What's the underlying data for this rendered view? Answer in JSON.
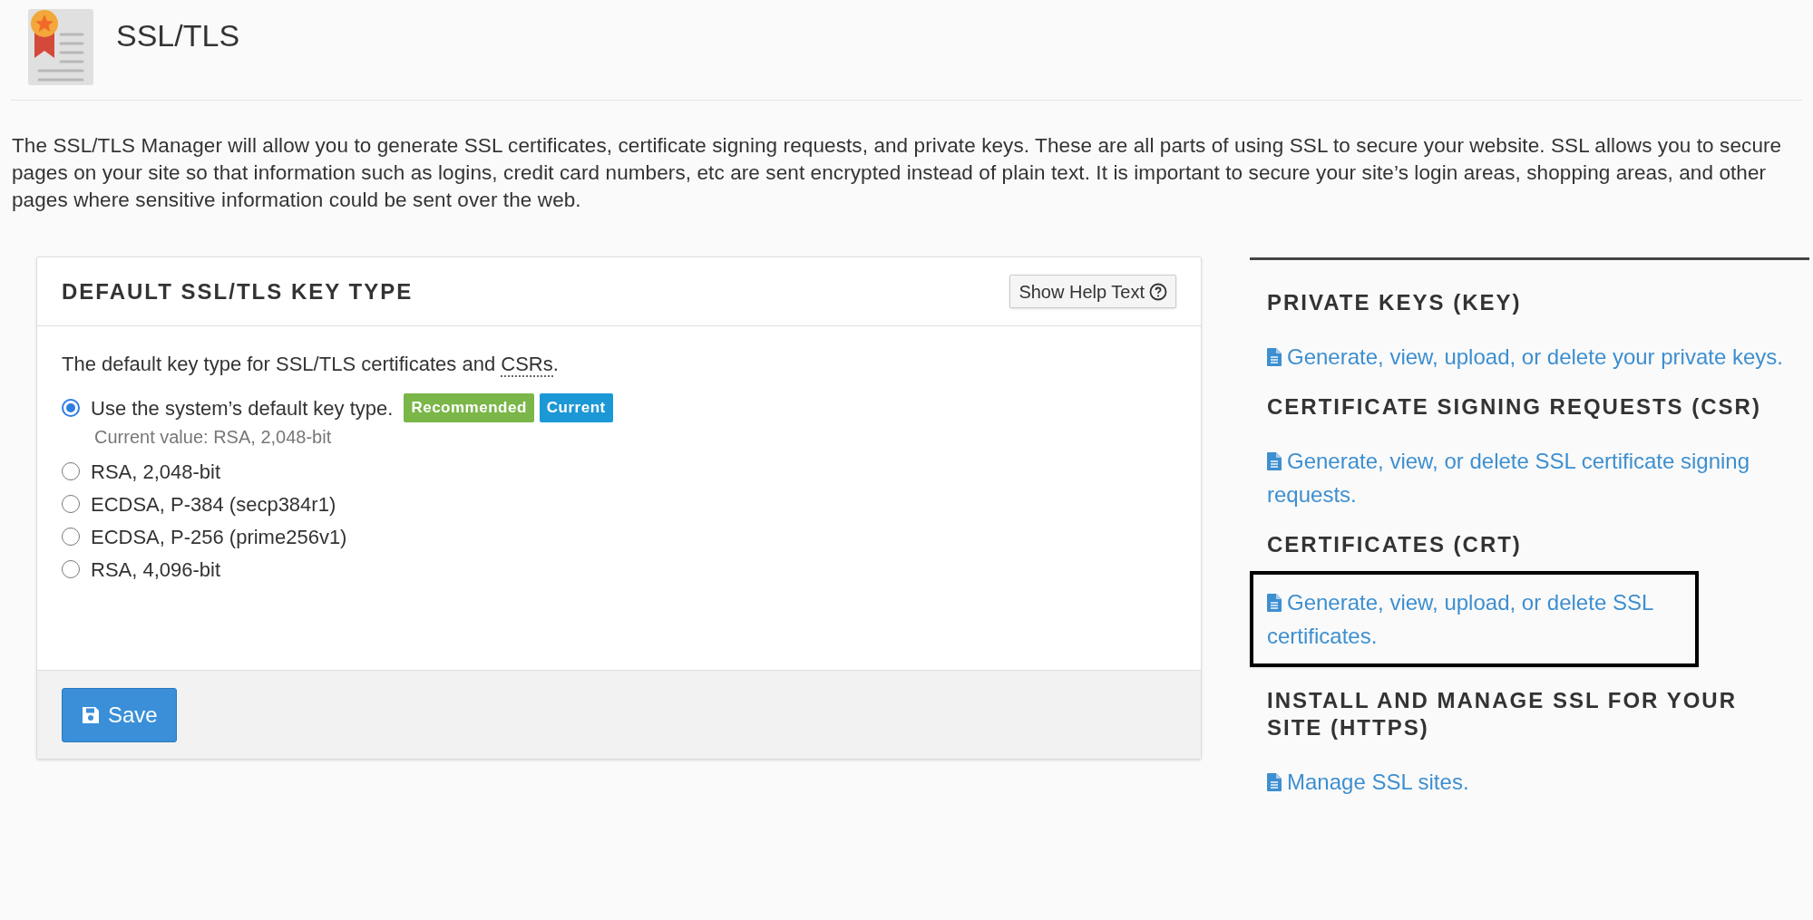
{
  "page": {
    "title": "SSL/TLS",
    "intro": "The SSL/TLS Manager will allow you to generate SSL certificates, certificate signing requests, and private keys. These are all parts of using SSL to secure your website. SSL allows you to secure pages on your site so that information such as logins, credit card numbers, etc are sent encrypted instead of plain text. It is important to secure your site’s login areas, shopping areas, and other pages where sensitive information could be sent over the web."
  },
  "key_type_panel": {
    "title": "DEFAULT SSL/TLS KEY TYPE",
    "help_button": "Show Help Text",
    "description": {
      "before": "The default key type for SSL/TLS certificates and ",
      "abbr": "CSRs",
      "after": "."
    },
    "options": [
      {
        "label": "Use the system’s default key type.",
        "selected": true,
        "badges": [
          {
            "label": "Recommended",
            "color": "#7ab648"
          },
          {
            "label": "Current",
            "color": "#1b98d5"
          }
        ],
        "note": "Current value: RSA, 2,048-bit"
      },
      {
        "label": "RSA, 2,048-bit",
        "selected": false
      },
      {
        "label": "ECDSA, P-384 (secp384r1)",
        "selected": false
      },
      {
        "label": "ECDSA, P-256 (prime256v1)",
        "selected": false
      },
      {
        "label": "RSA, 4,096-bit",
        "selected": false
      }
    ],
    "save_button": "Save"
  },
  "sections": [
    {
      "heading": "PRIVATE KEYS (KEY)",
      "link": "Generate, view, upload, or delete your private keys.",
      "highlighted": false
    },
    {
      "heading": "CERTIFICATE SIGNING REQUESTS (CSR)",
      "link": "Generate, view, or delete SSL certificate signing requests.",
      "highlighted": false
    },
    {
      "heading": "CERTIFICATES (CRT)",
      "link": "Generate, view, upload, or delete SSL certificates.",
      "highlighted": true
    },
    {
      "heading": "INSTALL AND MANAGE SSL FOR YOUR SITE (HTTPS)",
      "link": "Manage SSL sites.",
      "highlighted": false
    }
  ]
}
